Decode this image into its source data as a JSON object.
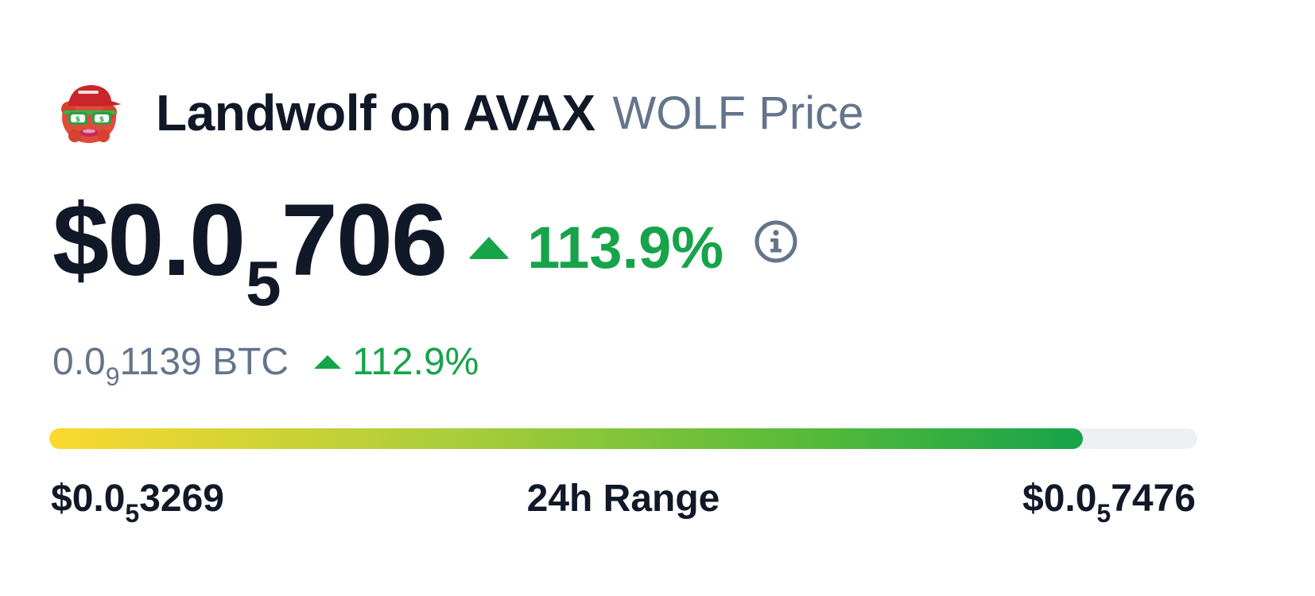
{
  "coin": {
    "name": "Landwolf on AVAX",
    "suffix": "WOLF Price",
    "logo_icon": "landwolf-logo"
  },
  "price": {
    "prefix": "$0.0",
    "zeros_subscript": "5",
    "digits": "706",
    "change_24h": "113.9%",
    "change_direction": "up",
    "info_icon": "info-icon"
  },
  "btc": {
    "prefix": "0.0",
    "zeros_subscript": "9",
    "digits": "1139 BTC",
    "change": "112.9%",
    "change_direction": "up"
  },
  "range": {
    "title": "24h Range",
    "low_prefix": "$0.0",
    "low_subscript": "5",
    "low_digits": "3269",
    "high_prefix": "$0.0",
    "high_subscript": "5",
    "high_digits": "7476",
    "position": 0.9
  },
  "colors": {
    "positive": "#16a34a",
    "muted": "#64748b",
    "text": "#111827",
    "track": "#eef1f4",
    "gradient_start": "#fbd930",
    "gradient_end": "#16a34a"
  }
}
